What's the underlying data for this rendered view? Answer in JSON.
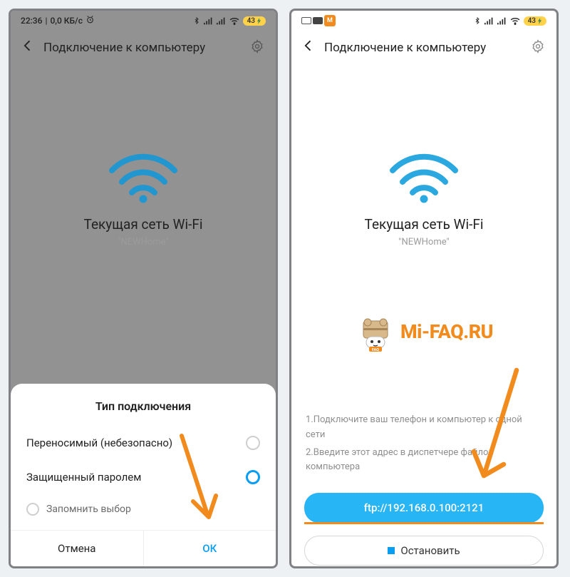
{
  "left": {
    "status_time": "22:36",
    "status_speed": "0,0 КБ/с",
    "battery": "43",
    "title": "Подключение к компьютеру",
    "wifi_label": "Текущая сеть Wi-Fi",
    "wifi_name": "\"NEWHome\"",
    "sheet_title": "Тип подключения",
    "option1": "Переносимый (небезопасно)",
    "option2": "Защищенный паролем",
    "remember": "Запомнить выбор",
    "cancel": "Отмена",
    "ok": "ОК"
  },
  "right": {
    "battery": "43",
    "title": "Подключение к компьютеру",
    "wifi_label": "Текущая сеть Wi-Fi",
    "wifi_name": "\"NEWHome\"",
    "logo_text": "Mi-FAQ.RU",
    "instruction1": "1.Подключите ваш телефон и компьютер к одной сети",
    "instruction2": "2.Введите этот адрес в диспетчере файлов компьютера",
    "ftp": "ftp://192.168.0.100:2121",
    "stop": "Остановить"
  }
}
